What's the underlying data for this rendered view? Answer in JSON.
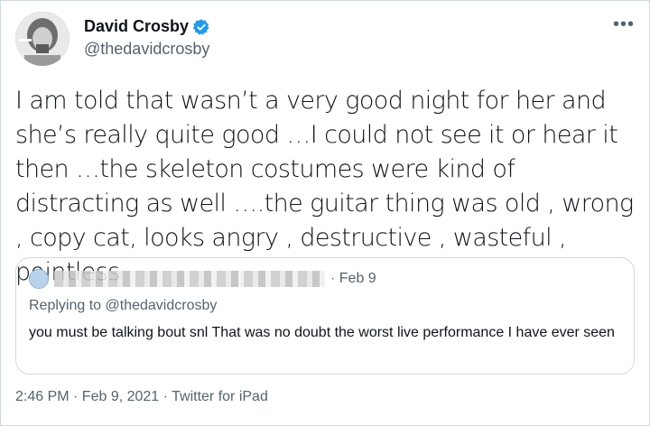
{
  "author": {
    "display_name": "David Crosby",
    "handle": "@thedavidcrosby",
    "verified_icon": "verified-badge-icon",
    "verified_color": "#1d9bf0"
  },
  "more_icon": "•••",
  "tweet": {
    "text": "I am told that wasn’t a very good night for her and she’s really quite good …I could not see it or hear it then …the skeleton costumes were kind of distracting as well ….the guitar thing was old , wrong , copy cat, looks angry , destructive , wasteful , pointless"
  },
  "quoted": {
    "date": "· Feb 9",
    "replying_prefix": "Replying to",
    "replying_handle": "@thedavidcrosby",
    "text": "you must be talking bout snl That was no doubt the worst live performance I have ever seen"
  },
  "footer": {
    "timestamp": "2:46 PM · Feb 9, 2021 · Twitter for iPad"
  }
}
